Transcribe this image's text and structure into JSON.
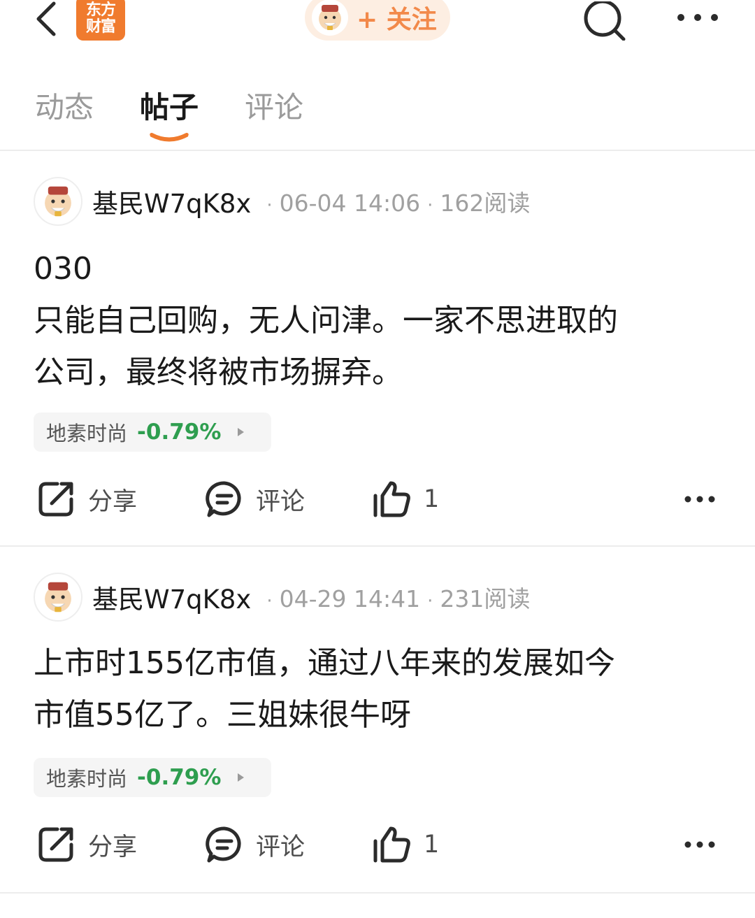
{
  "colors": {
    "brand_orange": "#f07b2e",
    "follow_bg": "#fdeee2",
    "follow_text": "#f2894a",
    "negative_green": "#2e9e4f",
    "icon_dark": "#2b2b2b"
  },
  "header": {
    "logo_text_line1": "东方",
    "logo_text_line2": "财富",
    "follow_label": "+ 关注",
    "icons": [
      "back-chevron-icon",
      "search-icon",
      "more-dots-icon"
    ]
  },
  "tabs": [
    {
      "label": "动态",
      "active": false
    },
    {
      "label": "帖子",
      "active": true
    },
    {
      "label": "评论",
      "active": false
    }
  ],
  "posts": [
    {
      "author": "基民W7qK8x",
      "time": "06-04 14:06",
      "reads": "162阅读",
      "lines": [
        "030",
        "只能自己回购，无人问津。一家不思进取的",
        "公司，最终将被市场摒弃。"
      ],
      "stock": {
        "name": "地素时尚",
        "change": "-0.79%"
      },
      "share_label": "分享",
      "comment_label": "评论",
      "like_count": "1"
    },
    {
      "author": "基民W7qK8x",
      "time": "04-29 14:41",
      "reads": "231阅读",
      "lines": [
        "上市时155亿市值，通过八年来的发展如今",
        "市值55亿了。三姐妹很牛呀"
      ],
      "stock": {
        "name": "地素时尚",
        "change": "-0.79%"
      },
      "share_label": "分享",
      "comment_label": "评论",
      "like_count": "1"
    }
  ]
}
